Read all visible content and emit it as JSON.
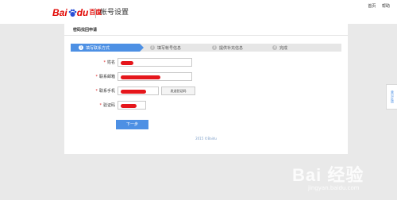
{
  "header": {
    "logo_text_left": "Bai",
    "logo_text_right": "du",
    "logo_cn": "百度",
    "title": "帐号设置",
    "links": [
      "首页",
      "帮助"
    ]
  },
  "panel": {
    "title": "密码找回申请",
    "steps": [
      {
        "num": "1",
        "label": "填写联系方式"
      },
      {
        "num": "2",
        "label": "填写帐号信息"
      },
      {
        "num": "3",
        "label": "提供补充信息"
      },
      {
        "num": "4",
        "label": "完成"
      }
    ],
    "active_step": 1,
    "fields": {
      "name_label": "姓名",
      "email_label": "联系邮箱",
      "phone_label": "联系手机",
      "code_label": "验证码"
    },
    "send_code_button": "发送验证码",
    "next_button": "下一步",
    "copyright": "2015 ©Baidu"
  },
  "side_tab": "意见反馈",
  "watermark": {
    "main": "Bai 经验",
    "sub": "jingyan.baidu.com"
  },
  "colors": {
    "brand_red": "#e10602",
    "accent_blue": "#4d90e4",
    "redaction": "#e5161b"
  }
}
